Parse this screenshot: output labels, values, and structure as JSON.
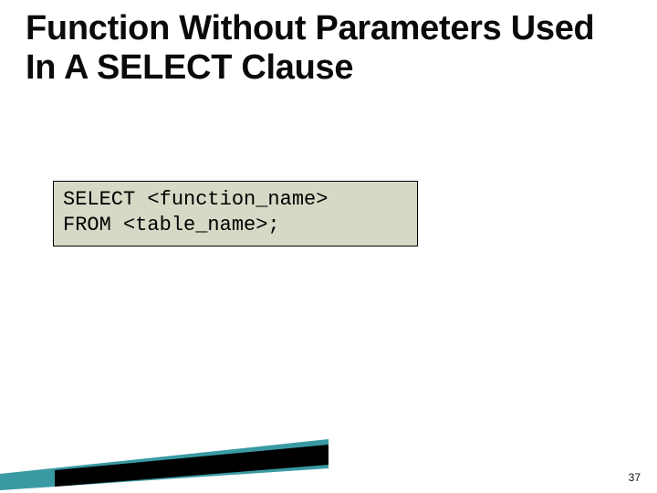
{
  "title": "Function Without Parameters Used In A SELECT Clause",
  "code": {
    "line1": "SELECT <function_name>",
    "line2": "FROM <table_name>;"
  },
  "page_number": "37",
  "accent": {
    "teal": "#3a9aa3",
    "black": "#000000"
  }
}
